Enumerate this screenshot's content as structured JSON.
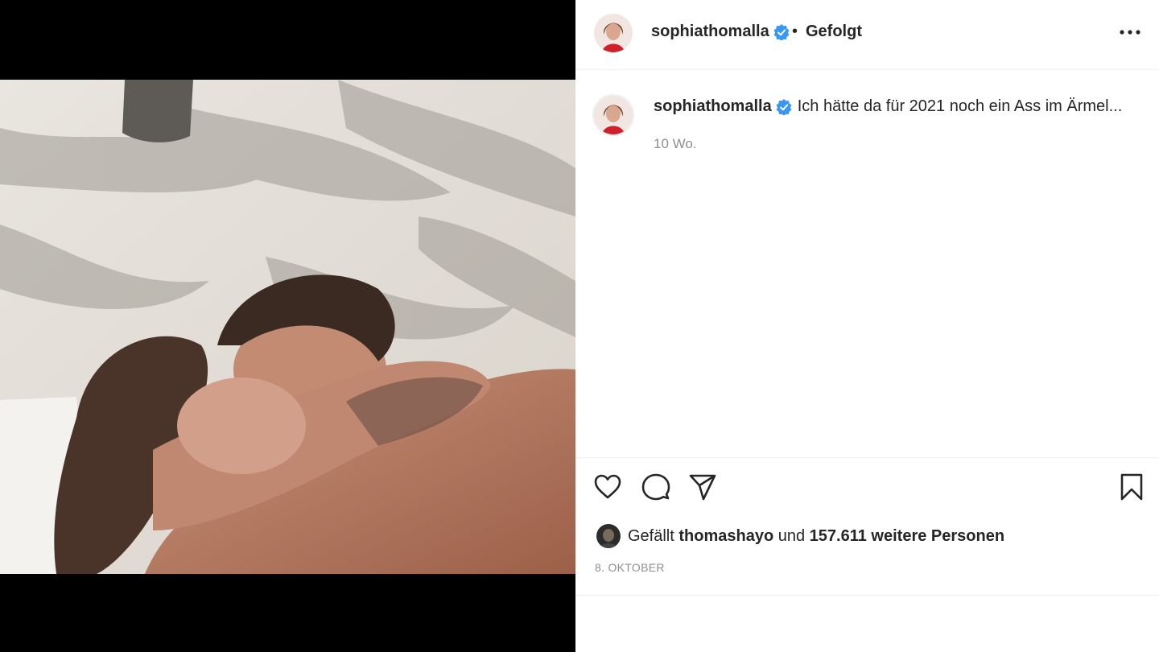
{
  "post": {
    "photo": {
      "description_icon": "beach-couple-photo"
    },
    "header": {
      "username": "sophiathomalla",
      "separator": "•",
      "follow_status": "Gefolgt"
    },
    "caption": {
      "username": "sophiathomalla",
      "text": "Ich hätte da für 2021 noch ein Ass im Ärmel...",
      "age": "10 Wo."
    },
    "actions": {
      "like_icon": "heart-icon",
      "comment_icon": "comment-icon",
      "share_icon": "paper-plane-icon",
      "save_icon": "bookmark-icon"
    },
    "likes": {
      "prefix": "Gefällt",
      "liker": "thomashayo",
      "conjunction": "und",
      "count_text": "157.611 weitere Personen"
    },
    "date": "8. OKTOBER",
    "colors": {
      "verified": "#3897f0",
      "accent_text": "#262626",
      "muted_text": "#8e8e8e"
    }
  }
}
